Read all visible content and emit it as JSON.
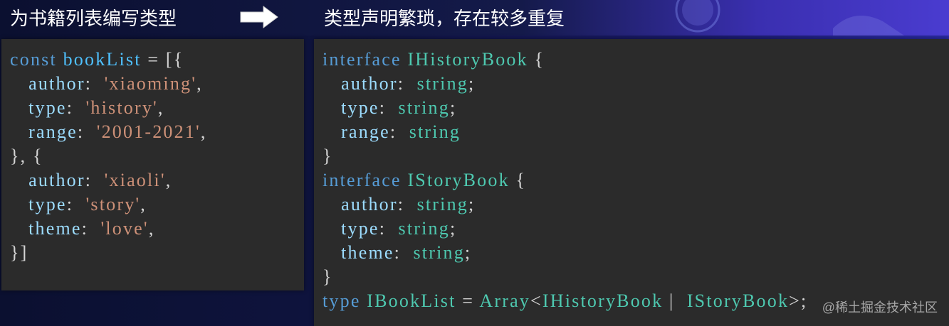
{
  "header": {
    "left_title": "为书籍列表编写类型",
    "right_title": "类型声明繁琐，存在较多重复",
    "arrow_icon": "right-arrow-icon"
  },
  "code_left": {
    "l1_kw": "const",
    "l1_var": "bookList",
    "l1_rest": " = [{",
    "l2_prop": "author",
    "l2_val": "'xiaoming'",
    "l3_prop": "type",
    "l3_val": "'history'",
    "l4_prop": "range",
    "l4_val": "'2001-2021'",
    "l5": "}, {",
    "l6_prop": "author",
    "l6_val": "'xiaoli'",
    "l7_prop": "type",
    "l7_val": "'story'",
    "l8_prop": "theme",
    "l8_val": "'love'",
    "l9": "}]"
  },
  "code_right": {
    "i1_kw": "interface",
    "i1_name": "IHistoryBook",
    "i1_p1": "author",
    "i1_p2": "type",
    "i1_p3": "range",
    "i2_kw": "interface",
    "i2_name": "IStoryBook",
    "i2_p1": "author",
    "i2_p2": "type",
    "i2_p3": "theme",
    "t_string": "string",
    "open_brace": "{",
    "close_brace": "}",
    "type_kw": "type",
    "type_name": "IBookList",
    "array": "Array",
    "union_a": "IHistoryBook",
    "union_b": "IStoryBook"
  },
  "watermark": "@稀土掘金技术社区"
}
